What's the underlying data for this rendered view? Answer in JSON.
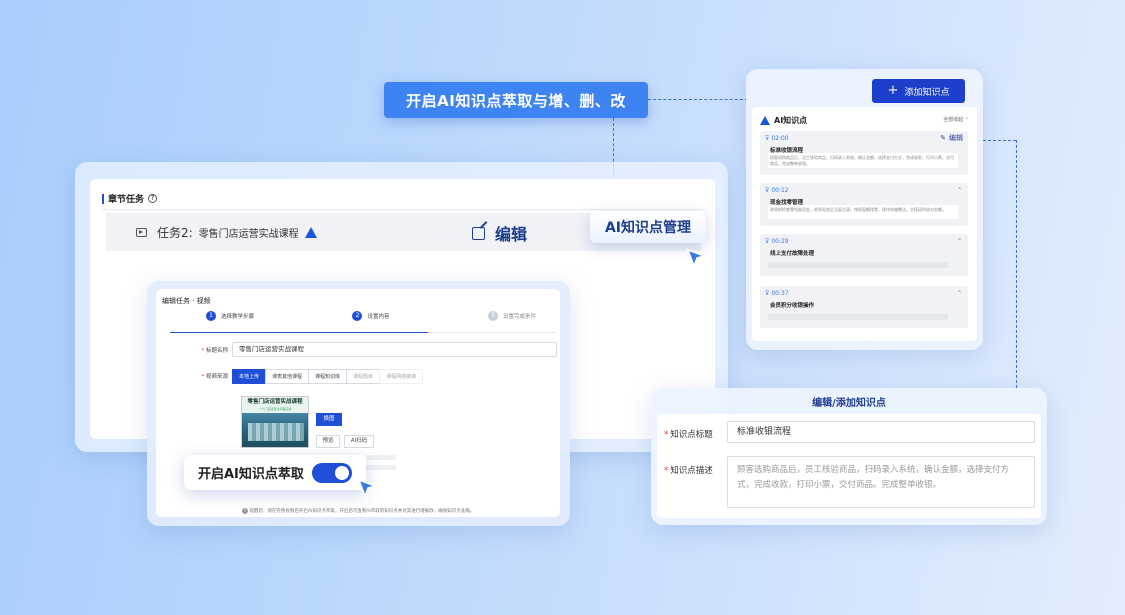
{
  "banner": {
    "text": "开启AI知识点萃取与增、删、改"
  },
  "chapter": {
    "section_title": "章节任务",
    "help_icon": "question-circle-icon",
    "task_label": "任务2:",
    "task_name": "零售门店运营实战课程",
    "task_icon": "video-icon",
    "logo_icon": "brand-logo-icon"
  },
  "edit_label": {
    "text": "编辑",
    "icon": "edit-icon"
  },
  "mgmt_label": {
    "text": "AI知识点管理"
  },
  "edit_form": {
    "title": "编辑任务 · 视频",
    "steps": [
      {
        "num": "1",
        "label": "选择教学步骤"
      },
      {
        "num": "2",
        "label": "设置内容"
      },
      {
        "num": "3",
        "label": "设置完成条件"
      }
    ],
    "name_label": "标题名称",
    "name_value": "零售门店运营实战课程",
    "source_label": "视频来源",
    "source_tabs": [
      "本地上传",
      "课表其他课程",
      "课程知识库",
      "课程题目",
      "课程网络链接"
    ],
    "thumb_title": "零售门店运营实战课程",
    "thumb_sub": "一个门店运营全流程实战",
    "btn_replace": "换图",
    "btn_preview": "预览",
    "btn_ai": "AI扫码",
    "note": "提醒您：请在完善视频后开启AI知识点萃取，开启后可查看AI萃取的知识点并对其进行增删改，确保知识点准确。"
  },
  "toggle": {
    "label": "开启AI知识点萃取",
    "on": true
  },
  "ai_panel": {
    "add_button": "添加知识点",
    "header": "AI知识点",
    "collapse_all": "全部收起",
    "edit_text": "编辑",
    "items": [
      {
        "time": "02:00",
        "title": "标准收银流程",
        "desc": "顾客选购商品后，员工核验商品，扫码录入系统，确认金额，选择支付方式，完成收款，打印小票，交付商品，完成整单收银。"
      },
      {
        "time": "00:12",
        "title": "现金找零管理",
        "desc": "收银前检查零钱备用金，收到现金后当面点清，按照面额找零，保持钱箱整洁，交接班时核对金额。"
      },
      {
        "time": "00:29",
        "title": "线上支付故障处理",
        "desc": ""
      },
      {
        "time": "00:37",
        "title": "会员积分收银操作",
        "desc": ""
      }
    ]
  },
  "kp_form": {
    "title": "编辑/添加知识点",
    "title_label": "知识点标题",
    "title_value": "标准收银流程",
    "desc_label": "知识点描述",
    "desc_value": "顾客选购商品后，员工核验商品，扫码录入系统，确认金额，选择支付方式，完成收款，打印小票，交付商品。完成整单收银。"
  },
  "colors": {
    "brand": "#1e4fd6",
    "banner": "#3d83f2",
    "title_blue": "#1e3d8f"
  }
}
